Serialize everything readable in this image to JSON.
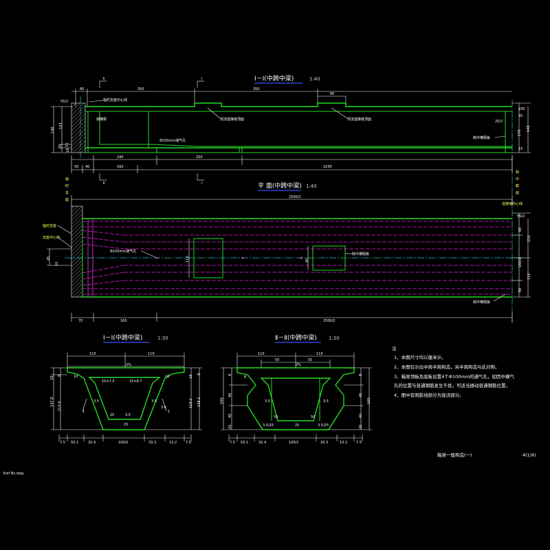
{
  "elevation": {
    "title": "Ⅰ－Ⅰ(中跨中梁)",
    "scale": "1:40",
    "dims_top": [
      "80",
      "350",
      "350",
      "80"
    ],
    "dims_left": [
      "55/2",
      "140",
      "103",
      "25",
      "15",
      "18"
    ],
    "dims_right": [
      "185",
      "35",
      "140",
      "170",
      "15"
    ],
    "dims_bottom": [
      "50",
      "40",
      "240",
      "160",
      "250",
      "1030"
    ],
    "labels": [
      "临时支座中心线",
      "端横梁",
      "现浇湿接缝顶面",
      "现浇湿接缝顶面",
      "Φ100mm通气孔",
      "跨中横隔板",
      "20/2"
    ],
    "section_marks": [
      "Ⅱ",
      "Ⅰ",
      "Ⅱ",
      "Ⅰ"
    ]
  },
  "plan": {
    "title": "平 面(中跨中梁)",
    "scale": "1:40",
    "overall_dim": "2500/2",
    "dims_right": [
      "55/2",
      "60",
      "110",
      "160/2",
      "110",
      "60"
    ],
    "dims_left": [
      "45",
      "10"
    ],
    "dims_bottom": [
      "70",
      "160",
      "2500/2"
    ],
    "labels": [
      "临时支座",
      "支座中心线",
      "Φ100mm通气孔",
      "跨中横隔板",
      "跨中横隔板",
      "湿接缝中心线"
    ],
    "hole_dims": [
      "110",
      "40"
    ]
  },
  "section1": {
    "title": "Ⅰ－Ⅰ(中跨中梁)",
    "scale": "1:30",
    "dims_top": [
      "110",
      "110"
    ],
    "dims_bottom": [
      "7.5",
      "50.1",
      "32.4",
      "100/2",
      "33.3",
      "13.2",
      "7.5"
    ],
    "dims_left": [
      "18",
      "8",
      "137.8",
      "113.4"
    ],
    "dims_right": [
      "18",
      "8",
      "119.2",
      "138.2"
    ],
    "inner_labels": [
      "2%",
      "10×7.5",
      "15×8.7",
      "3.5",
      "3.5",
      "3.5",
      "25",
      "1",
      "1",
      "10",
      "10",
      "20",
      "3.6"
    ]
  },
  "section2": {
    "title": "Ⅱ－Ⅱ(中跨中梁)",
    "scale": "1:30",
    "dims_top": [
      "110",
      "110",
      "55",
      "55"
    ],
    "dims_bottom": [
      "7.5",
      "50.1",
      "32.4",
      "100/2",
      "33.3",
      "13.2",
      "7.5"
    ],
    "dims_left": [
      "8",
      "40",
      "40",
      "20",
      "160"
    ],
    "dims_right": [
      "8",
      "40",
      "40",
      "20",
      "160"
    ],
    "inner_labels": [
      "2%",
      "8",
      "50",
      "50",
      "3.5",
      "3.5",
      "25",
      "3.5/25",
      "3.5/25"
    ]
  },
  "notes": {
    "heading": "注",
    "items": [
      "1、本图尺寸均以厘米计。",
      "2、本图仅示出中跨半跨构造，另半跨构造与此对称。",
      "3、箱梁顶板及底板设置4个Φ100mm的通气孔，如因中横气",
      "     孔的位置与普通钢筋发生干扰，可适当挪动普通钢筋位置。",
      "4、图中有阴影线部分为现浇部分。"
    ]
  },
  "footer": {
    "drawing_title": "箱梁一般构造(一)",
    "sheet_no": "4(1/6)",
    "xref": "Xref Bx.dwg"
  }
}
